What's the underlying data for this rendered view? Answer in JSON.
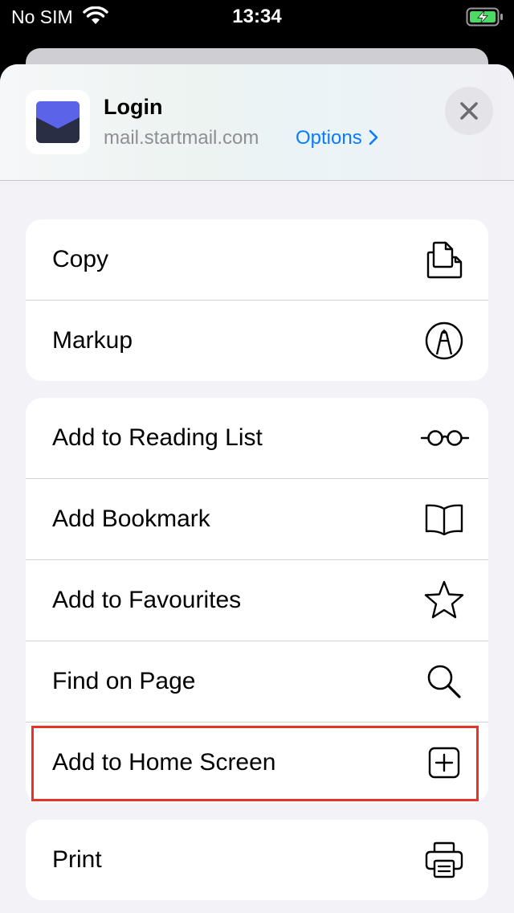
{
  "status_bar": {
    "carrier": "No SIM",
    "time": "13:34"
  },
  "share_sheet": {
    "header": {
      "title": "Login",
      "url": "mail.startmail.com",
      "options_label": "Options",
      "app_icon": "startmail-envelope-icon"
    },
    "groups": [
      {
        "items": [
          {
            "label": "Copy",
            "icon": "copy-icon"
          },
          {
            "label": "Markup",
            "icon": "markup-icon"
          }
        ]
      },
      {
        "items": [
          {
            "label": "Add to Reading List",
            "icon": "glasses-icon"
          },
          {
            "label": "Add Bookmark",
            "icon": "book-icon"
          },
          {
            "label": "Add to Favourites",
            "icon": "star-icon"
          },
          {
            "label": "Find on Page",
            "icon": "search-icon"
          },
          {
            "label": "Add to Home Screen",
            "icon": "add-square-icon",
            "highlighted": true
          }
        ]
      },
      {
        "items": [
          {
            "label": "Print",
            "icon": "printer-icon"
          }
        ]
      }
    ]
  },
  "colors": {
    "accent": "#0a7aff",
    "highlight": "#e83325",
    "sheet_background": "#f2f2f7",
    "battery_charging": "#4cd964",
    "startmail_brand": "#5b63e8"
  }
}
